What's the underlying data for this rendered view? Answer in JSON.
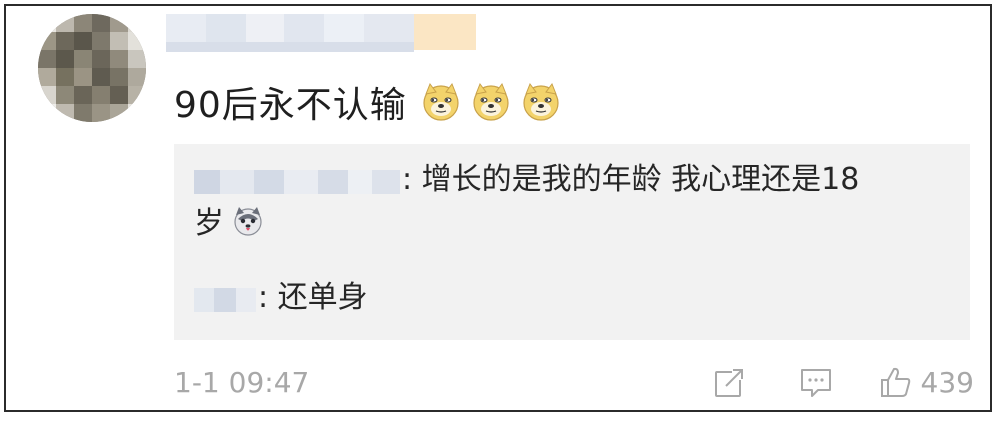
{
  "comment": {
    "text": "90后永不认输",
    "emoji_icons": [
      "doge-icon",
      "doge-icon",
      "doge-icon"
    ]
  },
  "replies": [
    {
      "separator": ":",
      "text": " 增长的是我的年龄 我心理还是18",
      "text_continued": "岁",
      "emoji_icon": "husky-icon"
    },
    {
      "separator": ":",
      "text": " 还单身"
    }
  ],
  "footer": {
    "timestamp": "1-1 09:47",
    "like_count": "439",
    "icons": [
      "share-icon",
      "comment-icon",
      "like-icon"
    ]
  },
  "colors": {
    "reply_background": "#f2f2f2",
    "meta_text": "#a8a8a8",
    "frame_border": "#2b2b2b"
  }
}
